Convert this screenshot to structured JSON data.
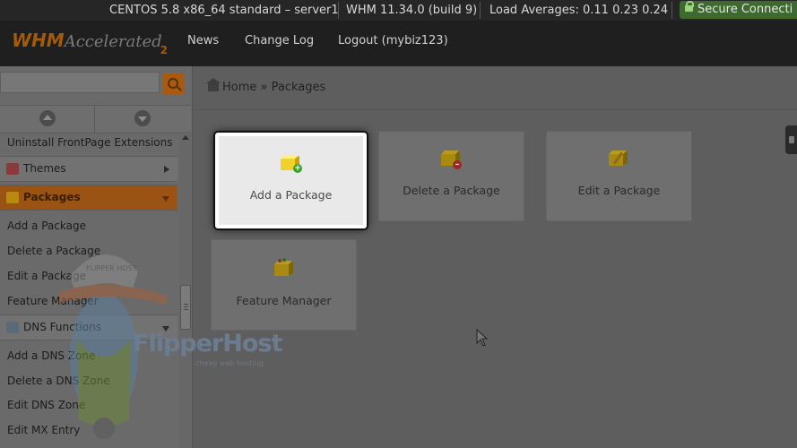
{
  "status": {
    "os": "CENTOS 5.8 x86_64 standard – server1",
    "version": "WHM 11.34.0 (build 9)",
    "load": "Load Averages: 0.11 0.23 0.24",
    "secure": "Secure Connecti"
  },
  "logo": {
    "whm": "WHM",
    "accelerated": "Accelerated",
    "num": "2"
  },
  "nav": {
    "news": "News",
    "changelog": "Change Log",
    "logout": "Logout (mybiz123)"
  },
  "search": {
    "value": "",
    "placeholder": ""
  },
  "sidebar": {
    "item_top": "Uninstall FrontPage Extensions",
    "themes": "Themes",
    "packages": "Packages",
    "packages_items": [
      "Add a Package",
      "Delete a Package",
      "Edit a Package",
      "Feature Manager"
    ],
    "dns": "DNS Functions",
    "dns_items": [
      "Add a DNS Zone",
      "Delete a DNS Zone",
      "Edit DNS Zone",
      "Edit MX Entry"
    ]
  },
  "watermark": {
    "name": "FlipperHost",
    "hat": "FLIPPER HOST",
    "sub": "cheap web hosting"
  },
  "breadcrumb": {
    "home": "Home",
    "sep": "»",
    "current": "Packages"
  },
  "tiles": {
    "add": "Add a Package",
    "delete": "Delete a Package",
    "edit": "Edit a Package",
    "feature": "Feature Manager"
  },
  "colors": {
    "accent": "#a85b10",
    "topbar": "#262626",
    "selected_tile": "#e9e9e9"
  }
}
